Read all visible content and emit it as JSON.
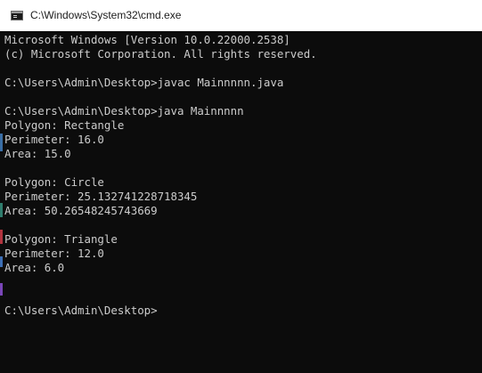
{
  "window": {
    "title": "C:\\Windows\\System32\\cmd.exe",
    "icon": "cmd-console-icon"
  },
  "console": {
    "lines": [
      "Microsoft Windows [Version 10.0.22000.2538]",
      "(c) Microsoft Corporation. All rights reserved.",
      "",
      "C:\\Users\\Admin\\Desktop>javac Mainnnnn.java",
      "",
      "C:\\Users\\Admin\\Desktop>java Mainnnnn",
      "Polygon: Rectangle",
      "Perimeter: 16.0",
      "Area: 15.0",
      "",
      "Polygon: Circle",
      "Perimeter: 25.132741228718345",
      "Area: 50.26548245743669",
      "",
      "Polygon: Triangle",
      "Perimeter: 12.0",
      "Area: 6.0",
      "",
      "",
      "C:\\Users\\Admin\\Desktop>"
    ]
  },
  "colors": {
    "console_bg": "#0c0c0c",
    "console_text": "#cccccc",
    "titlebar_bg": "#ffffff"
  }
}
